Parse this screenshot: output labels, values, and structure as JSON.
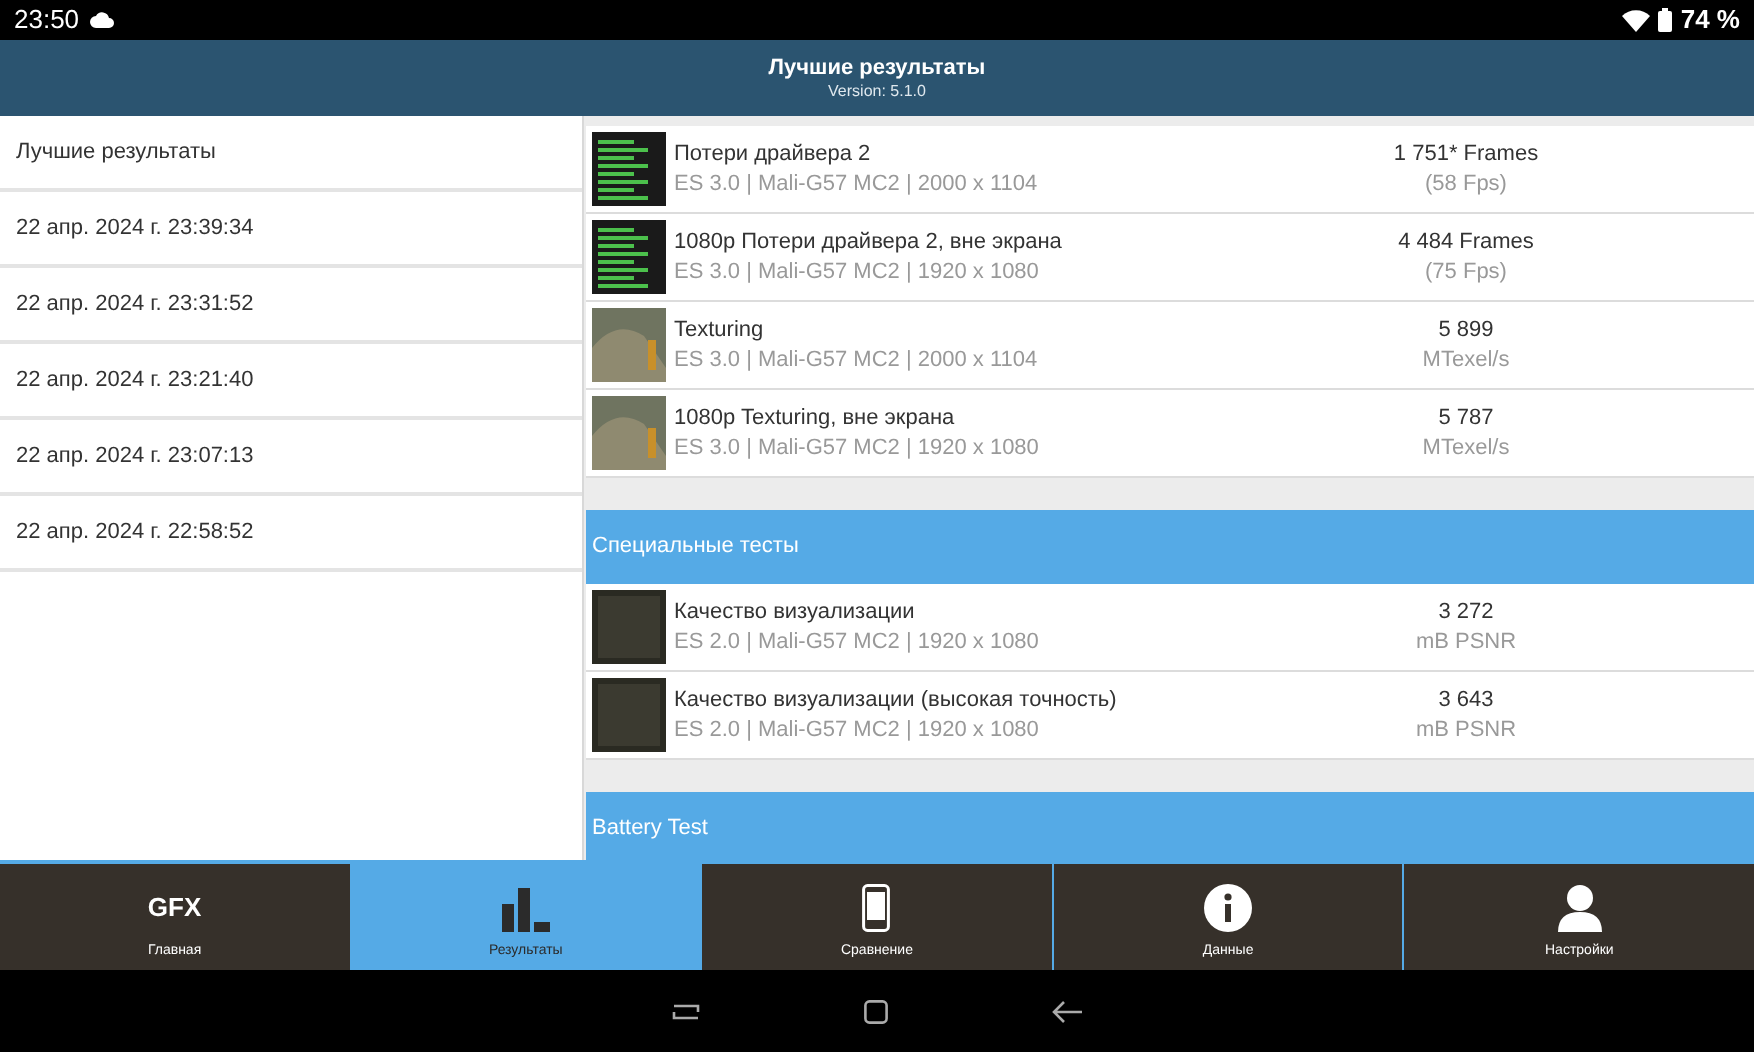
{
  "status_bar": {
    "time": "23:50",
    "battery": "74 %"
  },
  "header": {
    "title": "Лучшие результаты",
    "subtitle": "Version: 5.1.0"
  },
  "sidebar": {
    "items": [
      {
        "label": "Лучшие результаты"
      },
      {
        "label": "22 апр. 2024 г. 23:39:34"
      },
      {
        "label": "22 апр. 2024 г. 23:31:52"
      },
      {
        "label": "22 апр. 2024 г. 23:21:40"
      },
      {
        "label": "22 апр. 2024 г. 23:07:13"
      },
      {
        "label": "22 апр. 2024 г. 22:58:52"
      }
    ]
  },
  "results": [
    {
      "kind": "tests",
      "tests": [
        {
          "kind": "bars",
          "name": "Потери драйвера 2",
          "details": "ES 3.0 | Mali-G57 MC2 | 2000 x 1104",
          "score": "1 751* Frames",
          "unit": "(58 Fps)"
        },
        {
          "kind": "bars",
          "name": "1080p Потери драйвера 2, вне экрана",
          "details": "ES 3.0 | Mali-G57 MC2 | 1920 x 1080",
          "score": "4 484 Frames",
          "unit": "(75 Fps)"
        },
        {
          "kind": "scene",
          "name": "Texturing",
          "details": "ES 3.0 | Mali-G57 MC2 | 2000 x 1104",
          "score": "5 899",
          "unit": "MTexel/s"
        },
        {
          "kind": "scene",
          "name": "1080p Texturing, вне экрана",
          "details": "ES 3.0 | Mali-G57 MC2 | 1920 x 1080",
          "score": "5 787",
          "unit": "MTexel/s"
        }
      ]
    },
    {
      "kind": "section",
      "title": "Специальные тесты"
    },
    {
      "kind": "tests",
      "tests": [
        {
          "kind": "render",
          "name": "Качество визуализации",
          "details": "ES 2.0 | Mali-G57 MC2 | 1920 x 1080",
          "score": "3 272",
          "unit": "mB PSNR"
        },
        {
          "kind": "render",
          "name": "Качество визуализации (высокая точность)",
          "details": "ES 2.0 | Mali-G57 MC2 | 1920 x 1080",
          "score": "3 643",
          "unit": "mB PSNR"
        }
      ]
    },
    {
      "kind": "section",
      "title": "Battery Test"
    }
  ],
  "tabs": [
    {
      "label": "Главная",
      "icon": "GFX",
      "selected": false
    },
    {
      "label": "Результаты",
      "selected": true
    },
    {
      "label": "Сравнение",
      "selected": false
    },
    {
      "label": "Данные",
      "selected": false
    },
    {
      "label": "Настройки",
      "selected": false
    }
  ]
}
